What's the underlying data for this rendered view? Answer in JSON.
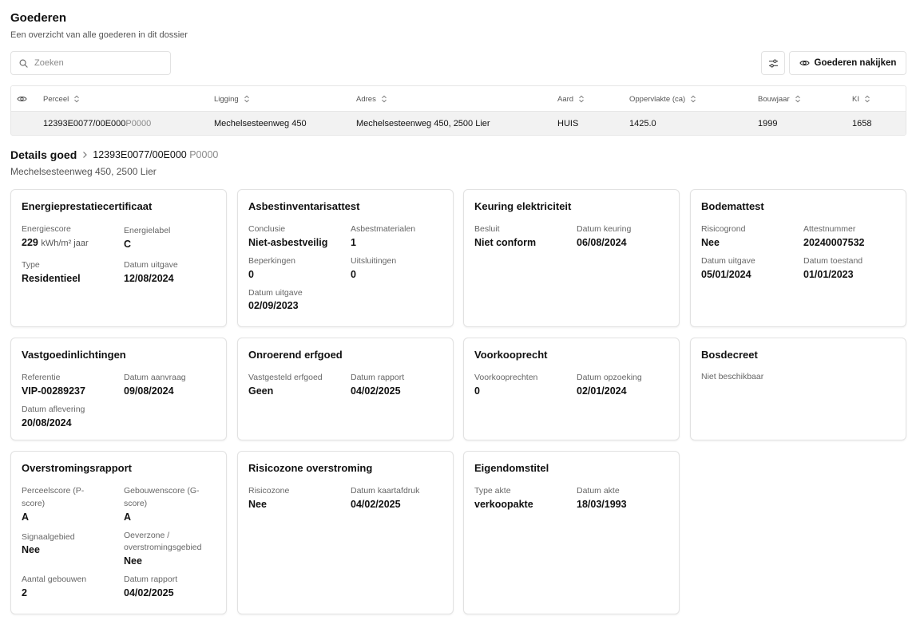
{
  "header": {
    "title": "Goederen",
    "subtitle": "Een overzicht van alle goederen in dit dossier"
  },
  "search": {
    "placeholder": "Zoeken",
    "value": ""
  },
  "toolbar": {
    "review_label": "Goederen nakijken"
  },
  "table": {
    "columns": [
      "Perceel",
      "Ligging",
      "Adres",
      "Aard",
      "Oppervlakte (ca)",
      "Bouwjaar",
      "KI"
    ],
    "row": {
      "perceel_main": "12393E0077/00E000",
      "perceel_suffix": "P0000",
      "ligging": "Mechelsesteenweg 450",
      "adres": "Mechelsesteenweg 450, 2500 Lier",
      "aard": "HUIS",
      "oppervlakte": "1425.0",
      "bouwjaar": "1999",
      "ki": "1658"
    }
  },
  "details": {
    "title": "Details goed",
    "crumb_main": "12393E0077/00E000",
    "crumb_suffix": "P0000",
    "address": "Mechelsesteenweg 450, 2500 Lier"
  },
  "cards": {
    "epc": {
      "title": "Energieprestatiecertificaat",
      "energiescore_label": "Energiescore",
      "energiescore_value": "229",
      "energiescore_unit": "kWh/m² jaar",
      "energielabel_label": "Energielabel",
      "energielabel_value": "C",
      "type_label": "Type",
      "type_value": "Residentieel",
      "datum_label": "Datum uitgave",
      "datum_value": "12/08/2024"
    },
    "asbest": {
      "title": "Asbestinventarisattest",
      "conclusie_label": "Conclusie",
      "conclusie_value": "Niet-asbestveilig",
      "materialen_label": "Asbestmaterialen",
      "materialen_value": "1",
      "beperkingen_label": "Beperkingen",
      "beperkingen_value": "0",
      "uitsluitingen_label": "Uitsluitingen",
      "uitsluitingen_value": "0",
      "datum_label": "Datum uitgave",
      "datum_value": "02/09/2023"
    },
    "elektriciteit": {
      "title": "Keuring elektriciteit",
      "besluit_label": "Besluit",
      "besluit_value": "Niet conform",
      "datum_label": "Datum keuring",
      "datum_value": "06/08/2024"
    },
    "bodem": {
      "title": "Bodemattest",
      "risicogrond_label": "Risicogrond",
      "risicogrond_value": "Nee",
      "attestnummer_label": "Attestnummer",
      "attestnummer_value": "20240007532",
      "uitgave_label": "Datum uitgave",
      "uitgave_value": "05/01/2024",
      "toestand_label": "Datum toestand",
      "toestand_value": "01/01/2023"
    },
    "vastgoed": {
      "title": "Vastgoedinlichtingen",
      "referentie_label": "Referentie",
      "referentie_value": "VIP-00289237",
      "aanvraag_label": "Datum aanvraag",
      "aanvraag_value": "09/08/2024",
      "aflevering_label": "Datum aflevering",
      "aflevering_value": "20/08/2024"
    },
    "erfgoed": {
      "title": "Onroerend erfgoed",
      "vastgesteld_label": "Vastgesteld erfgoed",
      "vastgesteld_value": "Geen",
      "rapport_label": "Datum rapport",
      "rapport_value": "04/02/2025"
    },
    "voorkoop": {
      "title": "Voorkooprecht",
      "rechten_label": "Voorkooprechten",
      "rechten_value": "0",
      "opzoeking_label": "Datum opzoeking",
      "opzoeking_value": "02/01/2024"
    },
    "bos": {
      "title": "Bosdecreet",
      "na_text": "Niet beschikbaar"
    },
    "overstroming": {
      "title": "Overstromingsrapport",
      "pscore_label": "Perceelscore (P-score)",
      "pscore_value": "A",
      "gscore_label": "Gebouwenscore (G-score)",
      "gscore_value": "A",
      "signaal_label": "Signaalgebied",
      "signaal_value": "Nee",
      "oever_label": "Oeverzone / overstromingsgebied",
      "oever_value": "Nee",
      "gebouwen_label": "Aantal gebouwen",
      "gebouwen_value": "2",
      "rapport_label": "Datum rapport",
      "rapport_value": "04/02/2025"
    },
    "risicozone": {
      "title": "Risicozone overstroming",
      "zone_label": "Risicozone",
      "zone_value": "Nee",
      "kaart_label": "Datum kaartafdruk",
      "kaart_value": "04/02/2025"
    },
    "eigendom": {
      "title": "Eigendomstitel",
      "type_label": "Type akte",
      "type_value": "verkoopakte",
      "datum_label": "Datum akte",
      "datum_value": "18/03/1993"
    }
  },
  "icons": {
    "search": "search-icon",
    "filter": "sliders-icon",
    "review": "eye-icon",
    "column_visibility": "eye-icon",
    "sort": "sort-icon",
    "breadcrumb": "chevron-right-icon"
  }
}
